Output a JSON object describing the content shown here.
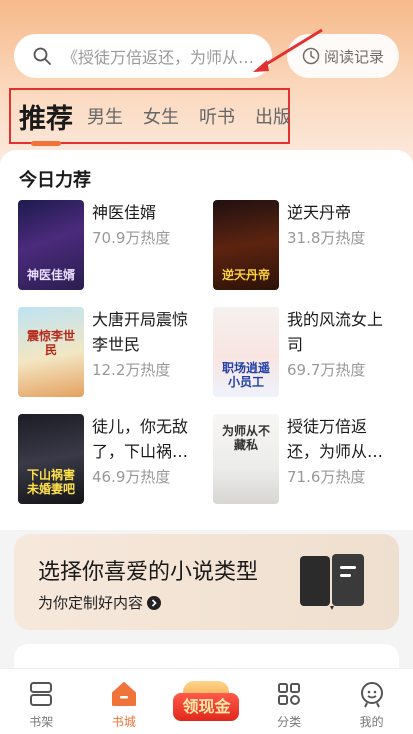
{
  "search": {
    "placeholder": "《授徒万倍返还，为师从不藏私》"
  },
  "history": {
    "label": "阅读记录"
  },
  "tabs": [
    {
      "label": "推荐",
      "active": true
    },
    {
      "label": "男生"
    },
    {
      "label": "女生"
    },
    {
      "label": "听书"
    },
    {
      "label": "出版"
    }
  ],
  "recommend": {
    "title": "今日力荐",
    "books": [
      {
        "title": "神医佳婿",
        "heat": "70.9万热度",
        "cover_text": "神医佳婿"
      },
      {
        "title": "逆天丹帝",
        "heat": "31.8万热度",
        "cover_text": "逆天丹帝"
      },
      {
        "title": "大唐开局震惊李世民",
        "heat": "12.2万热度",
        "cover_text": "震惊李世民"
      },
      {
        "title": "我的风流女上司",
        "heat": "69.7万热度",
        "cover_text": "职场逍遥小员工"
      },
      {
        "title": "徒儿，你无敌了，下山祸害…",
        "heat": "46.9万热度",
        "cover_text": "下山祸害未婚妻吧"
      },
      {
        "title": "授徒万倍返还，为师从不…",
        "heat": "71.6万热度",
        "cover_text": "为师从不藏私"
      }
    ]
  },
  "banner": {
    "title": "选择你喜爱的小说类型",
    "subtitle": "为你定制好内容"
  },
  "nav": [
    {
      "label": "书架",
      "icon": "bookshelf-icon"
    },
    {
      "label": "书城",
      "icon": "home-icon",
      "active": true
    },
    {
      "label": "领现金",
      "icon": "reward-icon"
    },
    {
      "label": "分类",
      "icon": "category-icon"
    },
    {
      "label": "我的",
      "icon": "profile-icon"
    }
  ],
  "colors": {
    "accent": "#f0733a",
    "annotation": "#e33030"
  }
}
